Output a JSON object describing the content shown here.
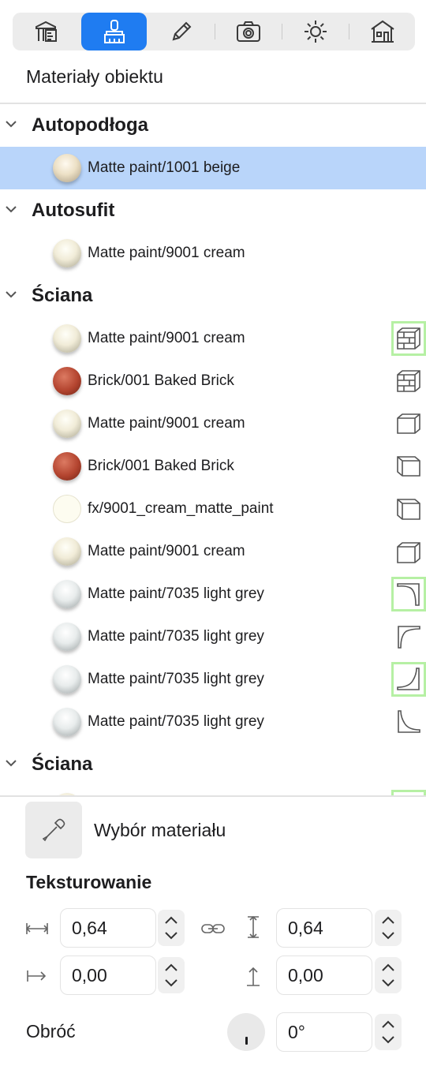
{
  "toolbar": {
    "tabs": [
      {
        "icon": "layout-tools-icon",
        "active": false
      },
      {
        "icon": "paint-brush-icon",
        "active": true
      },
      {
        "icon": "pencil-icon",
        "active": false
      },
      {
        "icon": "camera-icon",
        "active": false
      },
      {
        "icon": "sun-icon",
        "active": false
      },
      {
        "icon": "house-icon",
        "active": false
      }
    ],
    "accent": "#1f7cf1"
  },
  "panel": {
    "title": "Materiały obiektu"
  },
  "groups": [
    {
      "label": "Autopodłoga",
      "items": [
        {
          "label": "Matte paint/1001 beige",
          "swatch": "beige",
          "selected": true
        }
      ]
    },
    {
      "label": "Autosufit",
      "items": [
        {
          "label": "Matte paint/9001 cream",
          "swatch": "cream"
        }
      ]
    },
    {
      "label": "Ściana",
      "items": [
        {
          "label": "Matte paint/9001 cream",
          "swatch": "cream",
          "surface_icon": "brick-wall-icon",
          "highlighted": true
        },
        {
          "label": "Brick/001 Baked Brick",
          "swatch": "brick",
          "surface_icon": "brick-wall-icon"
        },
        {
          "label": "Matte paint/9001 cream",
          "swatch": "cream",
          "surface_icon": "wall-front-face-icon"
        },
        {
          "label": "Brick/001 Baked Brick",
          "swatch": "brick",
          "surface_icon": "wall-left-face-icon"
        },
        {
          "label": "fx/9001_cream_matte_paint",
          "swatch": "flat",
          "surface_icon": "wall-top-face-icon"
        },
        {
          "label": "Matte paint/9001 cream",
          "swatch": "cream",
          "surface_icon": "wall-side-face-icon"
        },
        {
          "label": "Matte paint/7035 light grey",
          "swatch": "grey",
          "surface_icon": "cornice-top-right-icon",
          "highlighted": true
        },
        {
          "label": "Matte paint/7035 light grey",
          "swatch": "grey",
          "surface_icon": "cornice-top-left-icon"
        },
        {
          "label": "Matte paint/7035 light grey",
          "swatch": "grey",
          "surface_icon": "cornice-bottom-right-icon",
          "highlighted": true
        },
        {
          "label": "Matte paint/7035 light grey",
          "swatch": "grey",
          "surface_icon": "cornice-bottom-left-icon"
        }
      ]
    },
    {
      "label": "Ściana",
      "items": []
    }
  ],
  "picker": {
    "label": "Wybór materiału",
    "icon": "eyedropper-icon"
  },
  "texturing": {
    "title": "Teksturowanie",
    "width": "0,64",
    "height": "0,64",
    "offset_x": "0,00",
    "offset_y": "0,00",
    "rotate_label": "Obróć",
    "rotation": "0°"
  }
}
